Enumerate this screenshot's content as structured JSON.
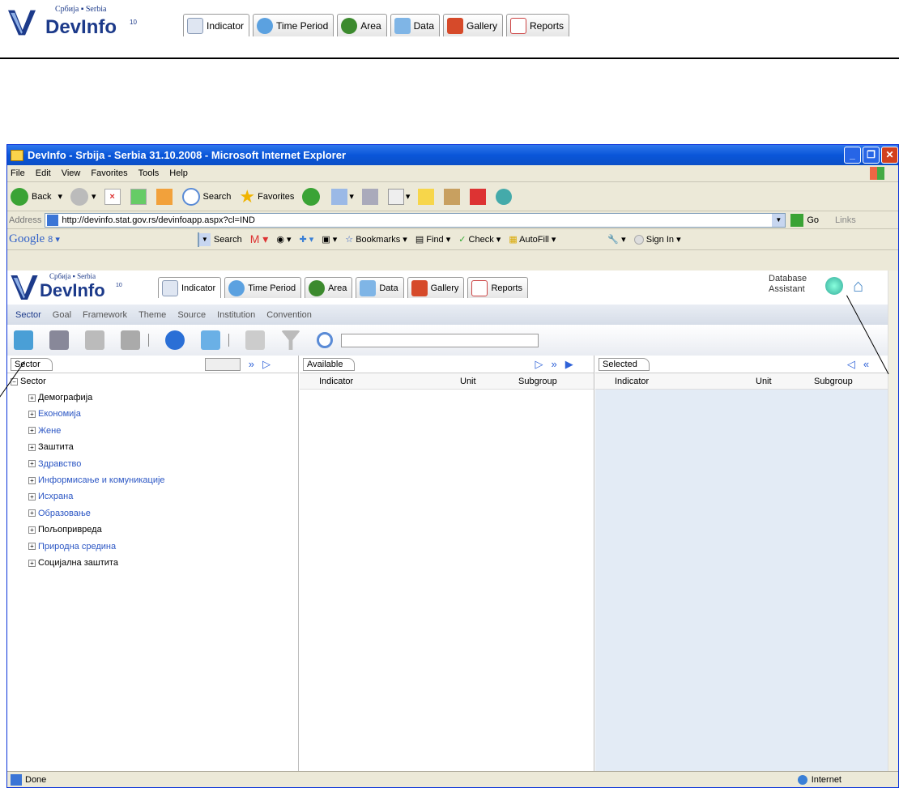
{
  "doc_header": {
    "logo_top": "Србија ▪ Serbia",
    "logo_name": "DevInfo",
    "logo_sup": "10",
    "tabs": [
      {
        "label": "Indicator",
        "color": "#dfe6f2"
      },
      {
        "label": "Time Period",
        "color": "#5ba1e0"
      },
      {
        "label": "Area",
        "color": "#3c8a2e"
      },
      {
        "label": "Data",
        "color": "#7fb5e6"
      },
      {
        "label": "Gallery",
        "color": "#d64a2a"
      },
      {
        "label": "Reports",
        "color": "#c44"
      }
    ]
  },
  "window": {
    "title": "DevInfo - Srbija - Serbia 31.10.2008 - Microsoft Internet Explorer",
    "menu": [
      "File",
      "Edit",
      "View",
      "Favorites",
      "Tools",
      "Help"
    ],
    "toolbar": {
      "back": "Back",
      "search": "Search",
      "favorites": "Favorites"
    },
    "address_label": "Address",
    "address_url": "http://devinfo.stat.gov.rs/devinfoapp.aspx?cl=IND",
    "go": "Go",
    "links": "Links",
    "google": {
      "logo": "Google",
      "logo_suffix": "8 ▾",
      "search": "Search",
      "bookmarks": "Bookmarks",
      "find": "Find",
      "check": "Check",
      "autofill": "AutoFill",
      "signin": "Sign In"
    },
    "status_left": "Done",
    "status_right": "Internet"
  },
  "app": {
    "db_assistant_line1": "Database",
    "db_assistant_line2": "Assistant",
    "subnav": [
      "Sector",
      "Goal",
      "Framework",
      "Theme",
      "Source",
      "Institution",
      "Convention"
    ],
    "sector_panel": {
      "tab": "Sector",
      "root": "Sector",
      "items": [
        {
          "label": "Демографија",
          "color": "#000"
        },
        {
          "label": "Економија",
          "color": "#2b56c4"
        },
        {
          "label": "Жене",
          "color": "#2b56c4"
        },
        {
          "label": "Заштита",
          "color": "#000"
        },
        {
          "label": "Здравство",
          "color": "#2b56c4"
        },
        {
          "label": "Информисање и комуникације",
          "color": "#2b56c4"
        },
        {
          "label": "Исхрана",
          "color": "#2b56c4"
        },
        {
          "label": "Образовање",
          "color": "#2b56c4"
        },
        {
          "label": "Пољопривреда",
          "color": "#000"
        },
        {
          "label": "Природна средина",
          "color": "#2b56c4"
        },
        {
          "label": "Социјална заштита",
          "color": "#000"
        }
      ]
    },
    "available_panel": {
      "tab": "Available",
      "cols": [
        "Indicator",
        "Unit",
        "Subgroup"
      ]
    },
    "selected_panel": {
      "tab": "Selected",
      "cols": [
        "Indicator",
        "Unit",
        "Subgroup"
      ]
    }
  }
}
